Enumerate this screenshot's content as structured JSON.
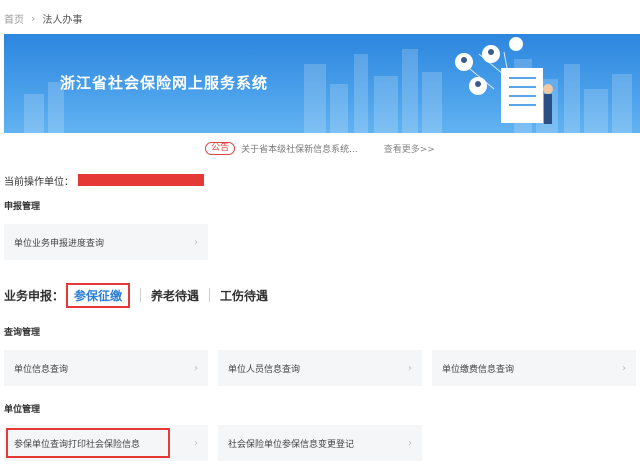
{
  "breadcrumb": {
    "home": "首页",
    "current": "法人办事"
  },
  "banner": {
    "title": "浙江省社会保险网上服务系统"
  },
  "notice": {
    "badge": "公告",
    "text": "关于省本级社保新信息系统...",
    "more": "查看更多>>"
  },
  "operator": {
    "label": "当前操作单位："
  },
  "sections": {
    "declare_mgmt": "申报管理",
    "query_mgmt": "查询管理",
    "unit_mgmt": "单位管理"
  },
  "declare_cards": [
    {
      "label": "单位业务申报进度查询"
    }
  ],
  "business_tabs": {
    "label": "业务申报：",
    "items": [
      {
        "label": "参保征缴",
        "active": true
      },
      {
        "label": "养老待遇",
        "active": false
      },
      {
        "label": "工伤待遇",
        "active": false
      }
    ]
  },
  "query_cards": [
    {
      "label": "单位信息查询"
    },
    {
      "label": "单位人员信息查询"
    },
    {
      "label": "单位缴费信息查询"
    }
  ],
  "unit_cards": [
    {
      "label": "参保单位查询打印社会保险信息"
    },
    {
      "label": "社会保险单位参保信息变更登记"
    }
  ],
  "chevron": "›",
  "colors": {
    "brand_blue": "#2d86de",
    "accent_red": "#e53935",
    "active_tab": "#2b7fd6"
  }
}
